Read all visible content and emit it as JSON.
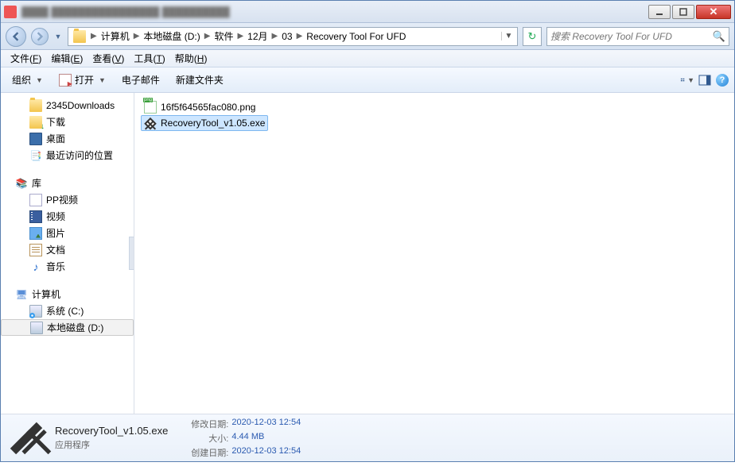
{
  "titlebar": {
    "text": "Recovery Tool For UFD"
  },
  "winbtns": {
    "min": "—",
    "max": "❐",
    "close": "✕"
  },
  "breadcrumbs": {
    "items": [
      "计算机",
      "本地磁盘 (D:)",
      "软件",
      "12月",
      "03",
      "Recovery Tool For UFD"
    ]
  },
  "search": {
    "placeholder": "搜索 Recovery Tool For UFD"
  },
  "menubar": {
    "file": "文件",
    "file_k": "F",
    "edit": "编辑",
    "edit_k": "E",
    "view": "查看",
    "view_k": "V",
    "tools": "工具",
    "tools_k": "T",
    "help": "帮助",
    "help_k": "H"
  },
  "toolbar": {
    "organize": "组织",
    "open": "打开",
    "email": "电子邮件",
    "newfolder": "新建文件夹"
  },
  "sidebar": {
    "downloads2345": "2345Downloads",
    "downloads": "下载",
    "desktop": "桌面",
    "recent": "最近访问的位置",
    "libraries": "库",
    "ppvideo": "PP视频",
    "videos": "视频",
    "pictures": "图片",
    "documents": "文档",
    "music": "音乐",
    "computer": "计算机",
    "drive_c": "系统 (C:)",
    "drive_d": "本地磁盘 (D:)"
  },
  "files": {
    "items": [
      {
        "name": "16f5f64565fac080.png",
        "type": "png",
        "selected": false
      },
      {
        "name": "RecoveryTool_v1.05.exe",
        "type": "exe",
        "selected": true
      }
    ]
  },
  "details": {
    "name": "RecoveryTool_v1.05.exe",
    "type": "应用程序",
    "modified_label": "修改日期:",
    "modified": "2020-12-03 12:54",
    "size_label": "大小:",
    "size": "4.44 MB",
    "created_label": "创建日期:",
    "created": "2020-12-03 12:54"
  }
}
